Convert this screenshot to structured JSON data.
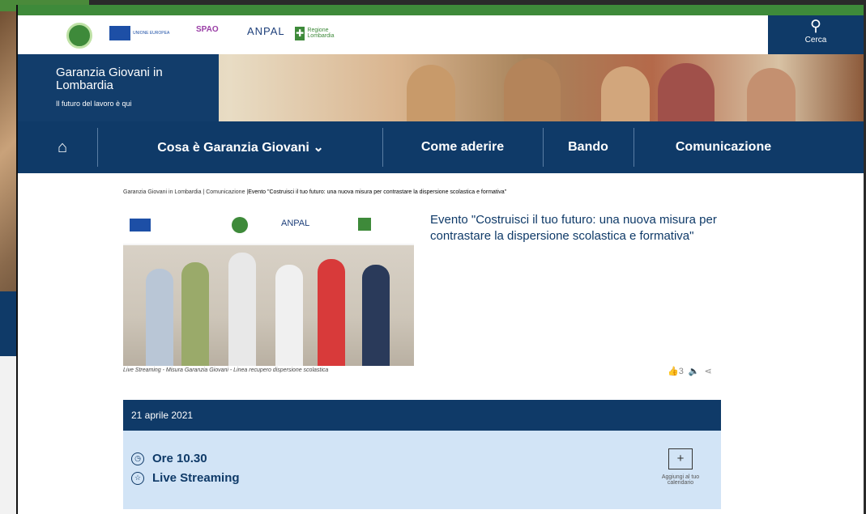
{
  "search": {
    "label": "Cerca"
  },
  "logos": {
    "eu": "UNIONE EUROPEA",
    "spao": "SPAO",
    "anpal": "ANPAL",
    "regione": "Regione Lombardia"
  },
  "hero": {
    "title": "Garanzia Giovani in Lombardia",
    "subtitle": "Il futuro del lavoro è qui"
  },
  "nav": {
    "home_icon": "home-icon",
    "items": [
      "Cosa è Garanzia Giovani ⌄",
      "Come aderire",
      "Bando",
      "Comunicazione"
    ]
  },
  "breadcrumb": {
    "part1": "Garanzia Giovani in Lombardia",
    "part2": "Comunicazione",
    "current": "Evento \"Costruisci il tuo futuro: una nuova misura per contrastare la dispersione scolastica e formativa\""
  },
  "event": {
    "title": "Evento \"Costruisci il tuo futuro: una nuova misura per contrastare la dispersione scolastica e formativa\"",
    "caption": "Live Streaming - Misura Garanzia Giovani - Linea recupero dispersione scolastica",
    "likes": "3",
    "date": "21 aprile 2021",
    "time": "Ore 10.30",
    "place": "Live Streaming",
    "calendar": "Aggiungi al tuo calendario"
  }
}
